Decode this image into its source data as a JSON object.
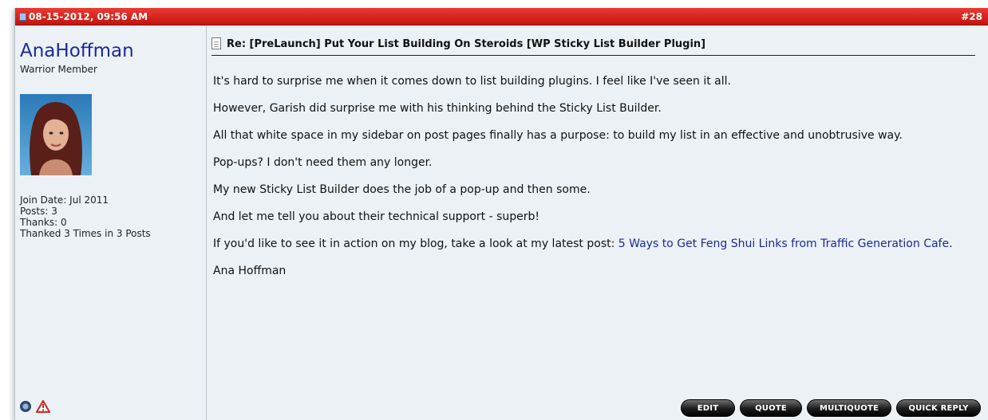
{
  "post": {
    "date": "08-15-2012, 09:56 AM",
    "number": "#28",
    "title": "Re: [PreLaunch] Put Your List Building On Steroids [WP Sticky List Builder Plugin]"
  },
  "user": {
    "name": "AnaHoffman",
    "title": "Warrior Member",
    "join_date": "Join Date: Jul 2011",
    "posts": "Posts: 3",
    "thanks": "Thanks: 0",
    "thanked": "Thanked 3 Times in 3 Posts"
  },
  "body": {
    "p1": "It's hard to surprise me when it comes down to list building plugins. I feel like I've seen it all.",
    "p2": "However, Garish did surprise me with his thinking behind the Sticky List Builder.",
    "p3": "All that white space in my sidebar on post pages finally has a purpose: to build my list in an effective and unobtrusive way.",
    "p4": "Pop-ups? I don't need them any longer.",
    "p5": "My new Sticky List Builder does the job of a pop-up and then some.",
    "p6": "And let me tell you about their technical support - superb!",
    "p7_text": "If you'd like to see it in action on my blog, take a look at my latest post: ",
    "p7_link": "5 Ways to Get Feng Shui Links from Traffic Generation Cafe",
    "p7_end": ".",
    "signature": "Ana Hoffman"
  },
  "buttons": {
    "edit": "EDIT",
    "quote": "QUOTE",
    "multiquote": "MULTIQUOTE",
    "quick_reply": "QUICK REPLY"
  },
  "colors": {
    "header_red": "#d3221b",
    "panel_bg": "#ecf1f5",
    "username_blue": "#1a2a9a",
    "link_blue": "#1a2a9a"
  },
  "icons": {
    "post_icon": "post-icon",
    "doc_icon": "document-icon",
    "online_icon": "online-status-icon",
    "report_icon": "report-post-icon"
  }
}
